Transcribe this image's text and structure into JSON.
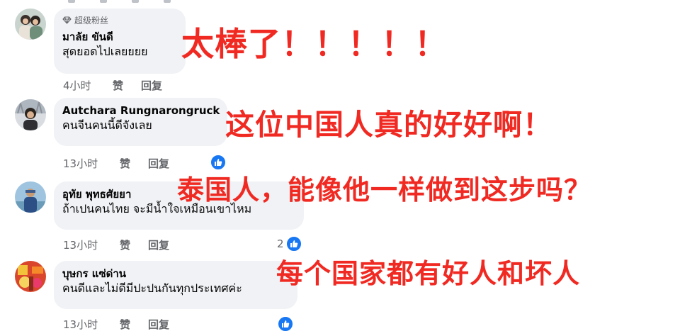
{
  "comments": [
    {
      "badge": "超级粉丝",
      "name": "มาลัย ขันดี",
      "text": "สุดยอดไปเลยยยย",
      "time": "4小时",
      "like_label": "赞",
      "reply_label": "回复",
      "reaction_count": ""
    },
    {
      "name": "Autchara Rungnarongruck",
      "text": "คนจีนคนนี้ดีจังเลย",
      "time": "13小时",
      "like_label": "赞",
      "reply_label": "回复",
      "reaction_count": ""
    },
    {
      "name": "อุทัย พุทธศัยยา",
      "text": "ถ้าเปนคนไทย จะมีน้ำใจเหมือนเขาไหม",
      "time": "13小时",
      "like_label": "赞",
      "reply_label": "回复",
      "reaction_count": "2"
    },
    {
      "name": "บุษกร แซ่ด่าน",
      "text": "คนดีและไม่ดีมีปะปนกันทุกประเทศค่ะ",
      "time": "13小时",
      "like_label": "赞",
      "reply_label": "回复",
      "reaction_count": ""
    }
  ],
  "overlays": [
    "太棒了！！！！！",
    "这位中国人真的好好啊！",
    "泰国人，能像他一样做到这步吗？",
    "每个国家都有好人和坏人"
  ],
  "colors": {
    "overlay_red": "#f02a22",
    "like_blue": "#1877f2",
    "bubble_bg": "#f0f2f5",
    "meta_gray": "#65676b"
  }
}
